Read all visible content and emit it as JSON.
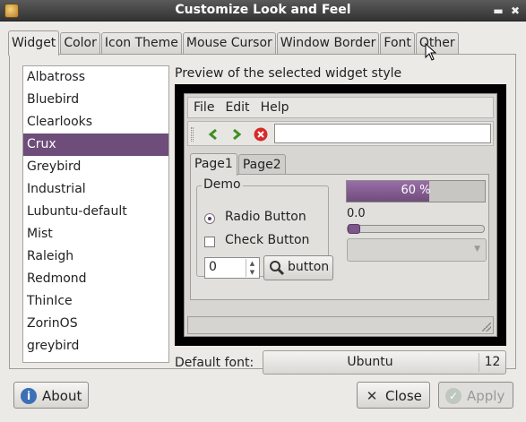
{
  "window": {
    "title": "Customize Look and Feel"
  },
  "tabs": [
    "Widget",
    "Color",
    "Icon Theme",
    "Mouse Cursor",
    "Window Border",
    "Font",
    "Other"
  ],
  "themes": {
    "items": [
      "Albatross",
      "Bluebird",
      "Clearlooks",
      "Crux",
      "Greybird",
      "Industrial",
      "Lubuntu-default",
      "Mist",
      "Raleigh",
      "Redmond",
      "ThinIce",
      "ZorinOS",
      "greybird"
    ],
    "selected": "Crux"
  },
  "preview": {
    "label": "Preview of the selected widget style",
    "menu": [
      "File",
      "Edit",
      "Help"
    ],
    "inner_tabs": [
      "Page1",
      "Page2"
    ],
    "demo": {
      "legend": "Demo",
      "radio_label": "Radio Button",
      "check_label": "Check Button",
      "spin_value": "0",
      "button_label": "button"
    },
    "progress": {
      "value": 0.6,
      "text": "60 %"
    },
    "scale_value": "0.0"
  },
  "font": {
    "label": "Default font:",
    "name": "Ubuntu",
    "size": "12"
  },
  "buttons": {
    "about": "About",
    "close": "Close",
    "apply": "Apply"
  },
  "icons": {
    "back": "arrow-left-icon",
    "forward": "arrow-right-icon",
    "stop": "stop-icon",
    "search": "magnifier-icon",
    "about": "info-icon",
    "close": "close-x-icon",
    "apply": "check-icon"
  },
  "colors": {
    "accent": "#6e4d7a",
    "titlebar": "#3e3e3e"
  }
}
